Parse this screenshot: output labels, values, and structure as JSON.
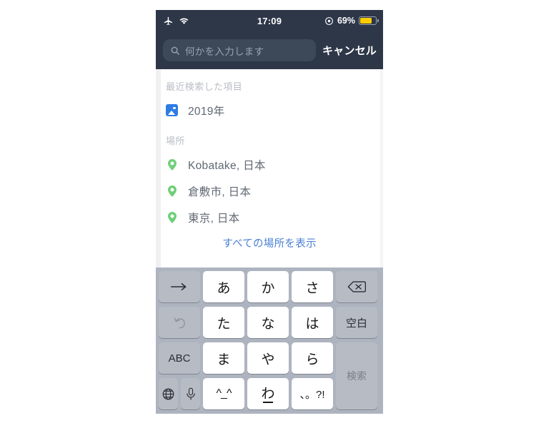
{
  "status_bar": {
    "airplane_icon": "airplane-mode-icon",
    "wifi_icon": "wifi-icon",
    "time": "17:09",
    "dnd_icon": "do-not-disturb-icon",
    "battery_percent": "69%",
    "battery_level": 69,
    "battery_color": "#ffcc00"
  },
  "search": {
    "icon": "search-icon",
    "placeholder": "何かを入力します",
    "value": "",
    "cancel_label": "キャンセル"
  },
  "sections": {
    "recent": {
      "header": "最近検索した項目",
      "items": [
        {
          "icon": "photo-icon",
          "label": "2019年"
        }
      ]
    },
    "places": {
      "header": "場所",
      "items": [
        {
          "icon": "map-pin-icon",
          "label": "Kobatake, 日本"
        },
        {
          "icon": "map-pin-icon",
          "label": "倉敷市, 日本"
        },
        {
          "icon": "map-pin-icon",
          "label": "東京, 日本"
        }
      ],
      "show_all_label": "すべての場所を表示"
    }
  },
  "keyboard": {
    "rows": [
      [
        {
          "name": "next-candidate-key",
          "label": "→",
          "type": "fn"
        },
        {
          "name": "key-a",
          "label": "あ",
          "type": "char"
        },
        {
          "name": "key-ka",
          "label": "か",
          "type": "char"
        },
        {
          "name": "key-sa",
          "label": "さ",
          "type": "char"
        },
        {
          "name": "delete-key",
          "label": "⌫",
          "type": "fn"
        }
      ],
      [
        {
          "name": "undo-key",
          "label": "↺",
          "type": "fn-muted"
        },
        {
          "name": "key-ta",
          "label": "た",
          "type": "char"
        },
        {
          "name": "key-na",
          "label": "な",
          "type": "char"
        },
        {
          "name": "key-ha",
          "label": "は",
          "type": "char"
        },
        {
          "name": "space-key",
          "label": "空白",
          "type": "fn"
        }
      ],
      [
        {
          "name": "abc-key",
          "label": "ABC",
          "type": "fn"
        },
        {
          "name": "key-ma",
          "label": "ま",
          "type": "char"
        },
        {
          "name": "key-ya",
          "label": "や",
          "type": "char"
        },
        {
          "name": "key-ra",
          "label": "ら",
          "type": "char"
        },
        {
          "name": "search-key",
          "label": "検索",
          "type": "search"
        }
      ],
      [
        {
          "name": "globe-key",
          "label": "🌐",
          "type": "fn"
        },
        {
          "name": "dictation-key",
          "label": "🎤",
          "type": "fn"
        },
        {
          "name": "emoticon-key",
          "label": "^_^",
          "type": "char"
        },
        {
          "name": "key-wa",
          "label": "わ",
          "type": "char"
        },
        {
          "name": "punctuation-key",
          "label": "、。?!",
          "type": "char"
        }
      ]
    ]
  },
  "colors": {
    "header_bg": "#2d3748",
    "search_field_bg": "#3d4859",
    "accent_link": "#4a7fd4",
    "pin_green": "#6fcf79",
    "photo_blue": "#2e7ce4",
    "keyboard_bg": "#aeb4bf",
    "key_char_bg": "#ffffff",
    "key_fn_bg": "#b6bbc4"
  }
}
